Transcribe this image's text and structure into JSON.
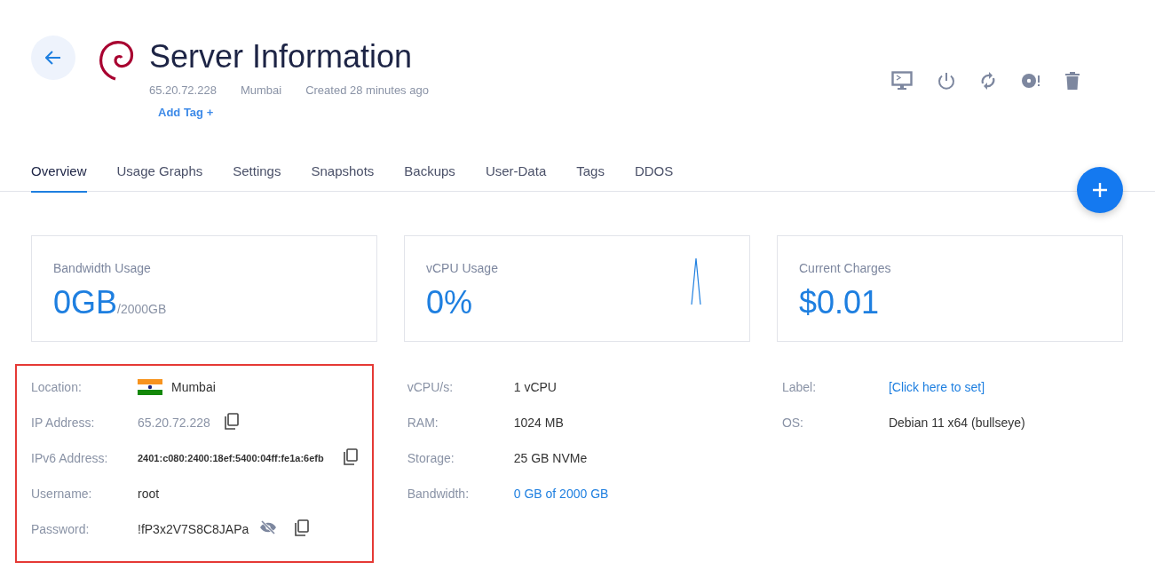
{
  "header": {
    "title": "Server Information",
    "meta": [
      "65.20.72.228",
      "Mumbai",
      "Created 28 minutes ago"
    ],
    "add_tag": "Add Tag +"
  },
  "tabs": [
    {
      "label": "Overview",
      "selected": true
    },
    {
      "label": "Usage Graphs",
      "selected": false
    },
    {
      "label": "Settings",
      "selected": false
    },
    {
      "label": "Snapshots",
      "selected": false
    },
    {
      "label": "Backups",
      "selected": false
    },
    {
      "label": "User-Data",
      "selected": false
    },
    {
      "label": "Tags",
      "selected": false
    },
    {
      "label": "DDOS",
      "selected": false
    }
  ],
  "cards": [
    {
      "label": "Bandwidth Usage",
      "value": "0GB",
      "unit": "/2000GB",
      "kind": "plain"
    },
    {
      "label": "vCPU Usage",
      "value": "0%",
      "kind": "sparkline"
    },
    {
      "label": "Current Charges",
      "value": "$0.01",
      "kind": "plain"
    }
  ],
  "details": [
    {
      "highlighted": true,
      "rows": [
        {
          "label": "Location:",
          "value": "Mumbai",
          "kind": "flag",
          "visibility_toggle": false,
          "copy": false
        },
        {
          "label": "IP Address:",
          "value": "65.20.72.228",
          "kind": "muted",
          "visibility_toggle": false,
          "copy": true
        },
        {
          "label": "IPv6 Address:",
          "value": "2401:c080:2400:18ef:5400:04ff:fe1a:6efb",
          "kind": "code",
          "visibility_toggle": false,
          "copy": true
        },
        {
          "label": "Username:",
          "value": "root",
          "kind": "plain",
          "visibility_toggle": false,
          "copy": false
        },
        {
          "label": "Password:",
          "value": "!fP3x2V7S8C8JAPa",
          "kind": "plain",
          "visibility_toggle": true,
          "copy": true
        }
      ]
    },
    {
      "highlighted": false,
      "rows": [
        {
          "label": "vCPU/s:",
          "value": "1 vCPU",
          "kind": "plain",
          "visibility_toggle": false,
          "copy": false
        },
        {
          "label": "RAM:",
          "value": "1024 MB",
          "kind": "plain",
          "visibility_toggle": false,
          "copy": false
        },
        {
          "label": "Storage:",
          "value": "25 GB NVMe",
          "kind": "plain",
          "visibility_toggle": false,
          "copy": false
        },
        {
          "label": "Bandwidth:",
          "value": "0 GB of 2000 GB",
          "kind": "link",
          "visibility_toggle": false,
          "copy": false
        }
      ]
    },
    {
      "highlighted": false,
      "rows": [
        {
          "label": "Label:",
          "value": "[Click here to set]",
          "kind": "link",
          "visibility_toggle": false,
          "copy": false
        },
        {
          "label": "OS:",
          "value": "Debian 11 x64 (bullseye)",
          "kind": "plain",
          "visibility_toggle": false,
          "copy": false
        }
      ]
    }
  ]
}
